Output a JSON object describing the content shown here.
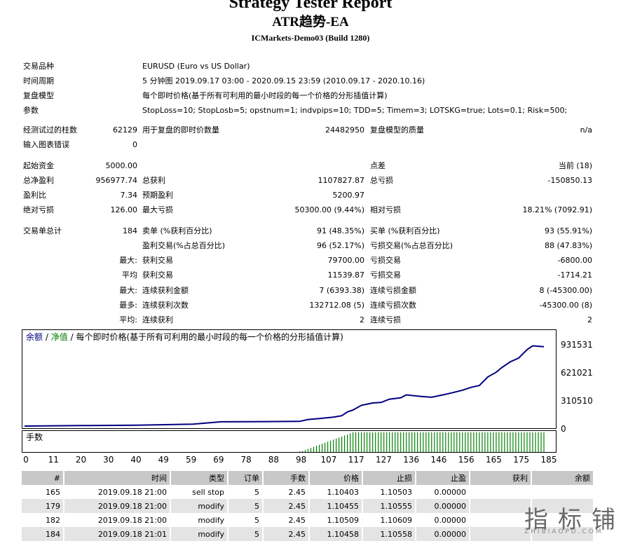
{
  "header": {
    "title": "Strategy Tester Report",
    "ea_name": "ATR趋势-EA",
    "server": "ICMarkets-Demo03 (Build 1280)"
  },
  "info": {
    "symbol_label": "交易品种",
    "symbol_value": "EURUSD (Euro vs US Dollar)",
    "period_label": "时间周期",
    "period_value": "5 分钟图 2019.09.17 03:00 - 2020.09.15 23:59 (2010.09.17 - 2020.10.16)",
    "model_label": "复盘模型",
    "model_value": "每个即时价格(基于所有可利用的最小时段的每一个价格的分形插值计算)",
    "params_label": "参数",
    "params_value": "StopLoss=10; StopLosb=5; opstnum=1; indvpips=10; TDD=5; Timem=3; LOTSKG=true; Lots=0.1; Risk=500;"
  },
  "stats": {
    "bars_label": "经测试过的柱数",
    "bars_value": "62129",
    "ticks_label": "用于复盘的即时价数量",
    "ticks_value": "24482950",
    "quality_label": "复盘模型的质量",
    "quality_value": "n/a",
    "errors_label": "输入图表错误",
    "errors_value": "0",
    "deposit_label": "起始资金",
    "deposit_value": "5000.00",
    "spread_label": "点差",
    "spread_value": "当前 (18)",
    "net_label": "总净盈利",
    "net_value": "956977.74",
    "gross_profit_label": "总获利",
    "gross_profit_value": "1107827.87",
    "gross_loss_label": "总亏损",
    "gross_loss_value": "-150850.13",
    "pf_label": "盈利比",
    "pf_value": "7.34",
    "payoff_label": "预期盈利",
    "payoff_value": "5200.97",
    "abs_dd_label": "绝对亏损",
    "abs_dd_value": "126.00",
    "max_dd_label": "最大亏损",
    "max_dd_value": "50300.00 (9.44%)",
    "rel_dd_label": "相对亏损",
    "rel_dd_value": "18.21% (7092.91)",
    "trades_label": "交易单总计",
    "trades_value": "184",
    "short_label": "卖单 (%获利百分比)",
    "short_value": "91 (48.35%)",
    "long_label": "买单 (%获利百分比)",
    "long_value": "93 (55.91%)",
    "win_label": "盈利交易(%占总百分比)",
    "win_value": "96 (52.17%)",
    "loss_label": "亏损交易(%占总百分比)",
    "loss_value": "88 (47.83%)",
    "largest_prefix": "最大:",
    "largest_win_label": "获利交易",
    "largest_win_value": "79700.00",
    "largest_loss_label": "亏损交易",
    "largest_loss_value": "-6800.00",
    "average_prefix": "平均",
    "avg_win_label": "获利交易",
    "avg_win_value": "11539.87",
    "avg_loss_label": "亏损交易",
    "avg_loss_value": "-1714.21",
    "max_prefix": "最大:",
    "max_cons_win_label": "连续获利金额",
    "max_cons_win_value": "7 (6393.38)",
    "max_cons_loss_label": "连续亏损金额",
    "max_cons_loss_value": "8 (-45300.00)",
    "most_prefix": "最多:",
    "most_cons_win_label": "连续获利次数",
    "most_cons_win_value": "132712.08 (5)",
    "most_cons_loss_label": "连续亏损次数",
    "most_cons_loss_value": "-45300.00 (8)",
    "avg_prefix": "平均:",
    "avg_cons_win_label": "连续获利",
    "avg_cons_win_value": "2",
    "avg_cons_loss_label": "连续亏损",
    "avg_cons_loss_value": "2"
  },
  "chart_data": {
    "type": "line",
    "title": "每个即时价格(基于所有可利用的最小时段的每一个价格的分形插值计算)",
    "series": [
      {
        "name": "余额",
        "color": "#000080",
        "x": [
          0,
          20,
          40,
          60,
          70,
          80,
          90,
          98,
          101,
          105,
          110,
          113,
          115,
          117,
          120,
          124,
          127,
          130,
          134,
          136,
          141,
          145,
          149,
          152,
          156,
          159,
          162,
          165,
          168,
          170,
          173,
          176,
          179,
          181,
          183,
          185
        ],
        "y": [
          0,
          5000,
          10000,
          20000,
          45000,
          47000,
          48000,
          50000,
          70000,
          80000,
          95000,
          110000,
          150000,
          170000,
          220000,
          245000,
          250000,
          285000,
          300000,
          330000,
          315000,
          305000,
          330000,
          350000,
          380000,
          410000,
          430000,
          520000,
          570000,
          620000,
          680000,
          720000,
          810000,
          850000,
          845000,
          840000
        ]
      },
      {
        "name": "净值",
        "color": "#008000"
      }
    ],
    "yticks": [
      "931531",
      "621021",
      "310510",
      "0"
    ],
    "xticks": [
      "0",
      "11",
      "20",
      "30",
      "40",
      "49",
      "59",
      "69",
      "78",
      "88",
      "98",
      "107",
      "117",
      "127",
      "136",
      "146",
      "156",
      "165",
      "175",
      "185"
    ],
    "volume_label": "手数",
    "volume_start_trade": 98,
    "volume_full_trade": 117,
    "xlim": [
      0,
      188
    ],
    "ylim": [
      0,
      950000
    ],
    "separator": "/"
  },
  "table": {
    "columns": [
      "#",
      "时间",
      "类型",
      "订单",
      "手数",
      "价格",
      "止损",
      "止盈",
      "获利",
      "余额"
    ],
    "rows": [
      [
        "165",
        "2019.09.18 21:00",
        "sell stop",
        "5",
        "2.45",
        "1.10403",
        "1.10503",
        "0.00000",
        "",
        ""
      ],
      [
        "179",
        "2019.09.18 21:00",
        "modify",
        "5",
        "2.45",
        "1.10455",
        "1.10555",
        "0.00000",
        "",
        ""
      ],
      [
        "182",
        "2019.09.18 21:00",
        "modify",
        "5",
        "2.45",
        "1.10509",
        "1.10609",
        "0.00000",
        "",
        ""
      ],
      [
        "184",
        "2019.09.18 21:01",
        "modify",
        "5",
        "2.45",
        "1.10458",
        "1.10558",
        "0.00000",
        "",
        ""
      ]
    ]
  },
  "watermark": {
    "cn": "指标铺",
    "en": "ZHIBIAOPU.COM"
  }
}
